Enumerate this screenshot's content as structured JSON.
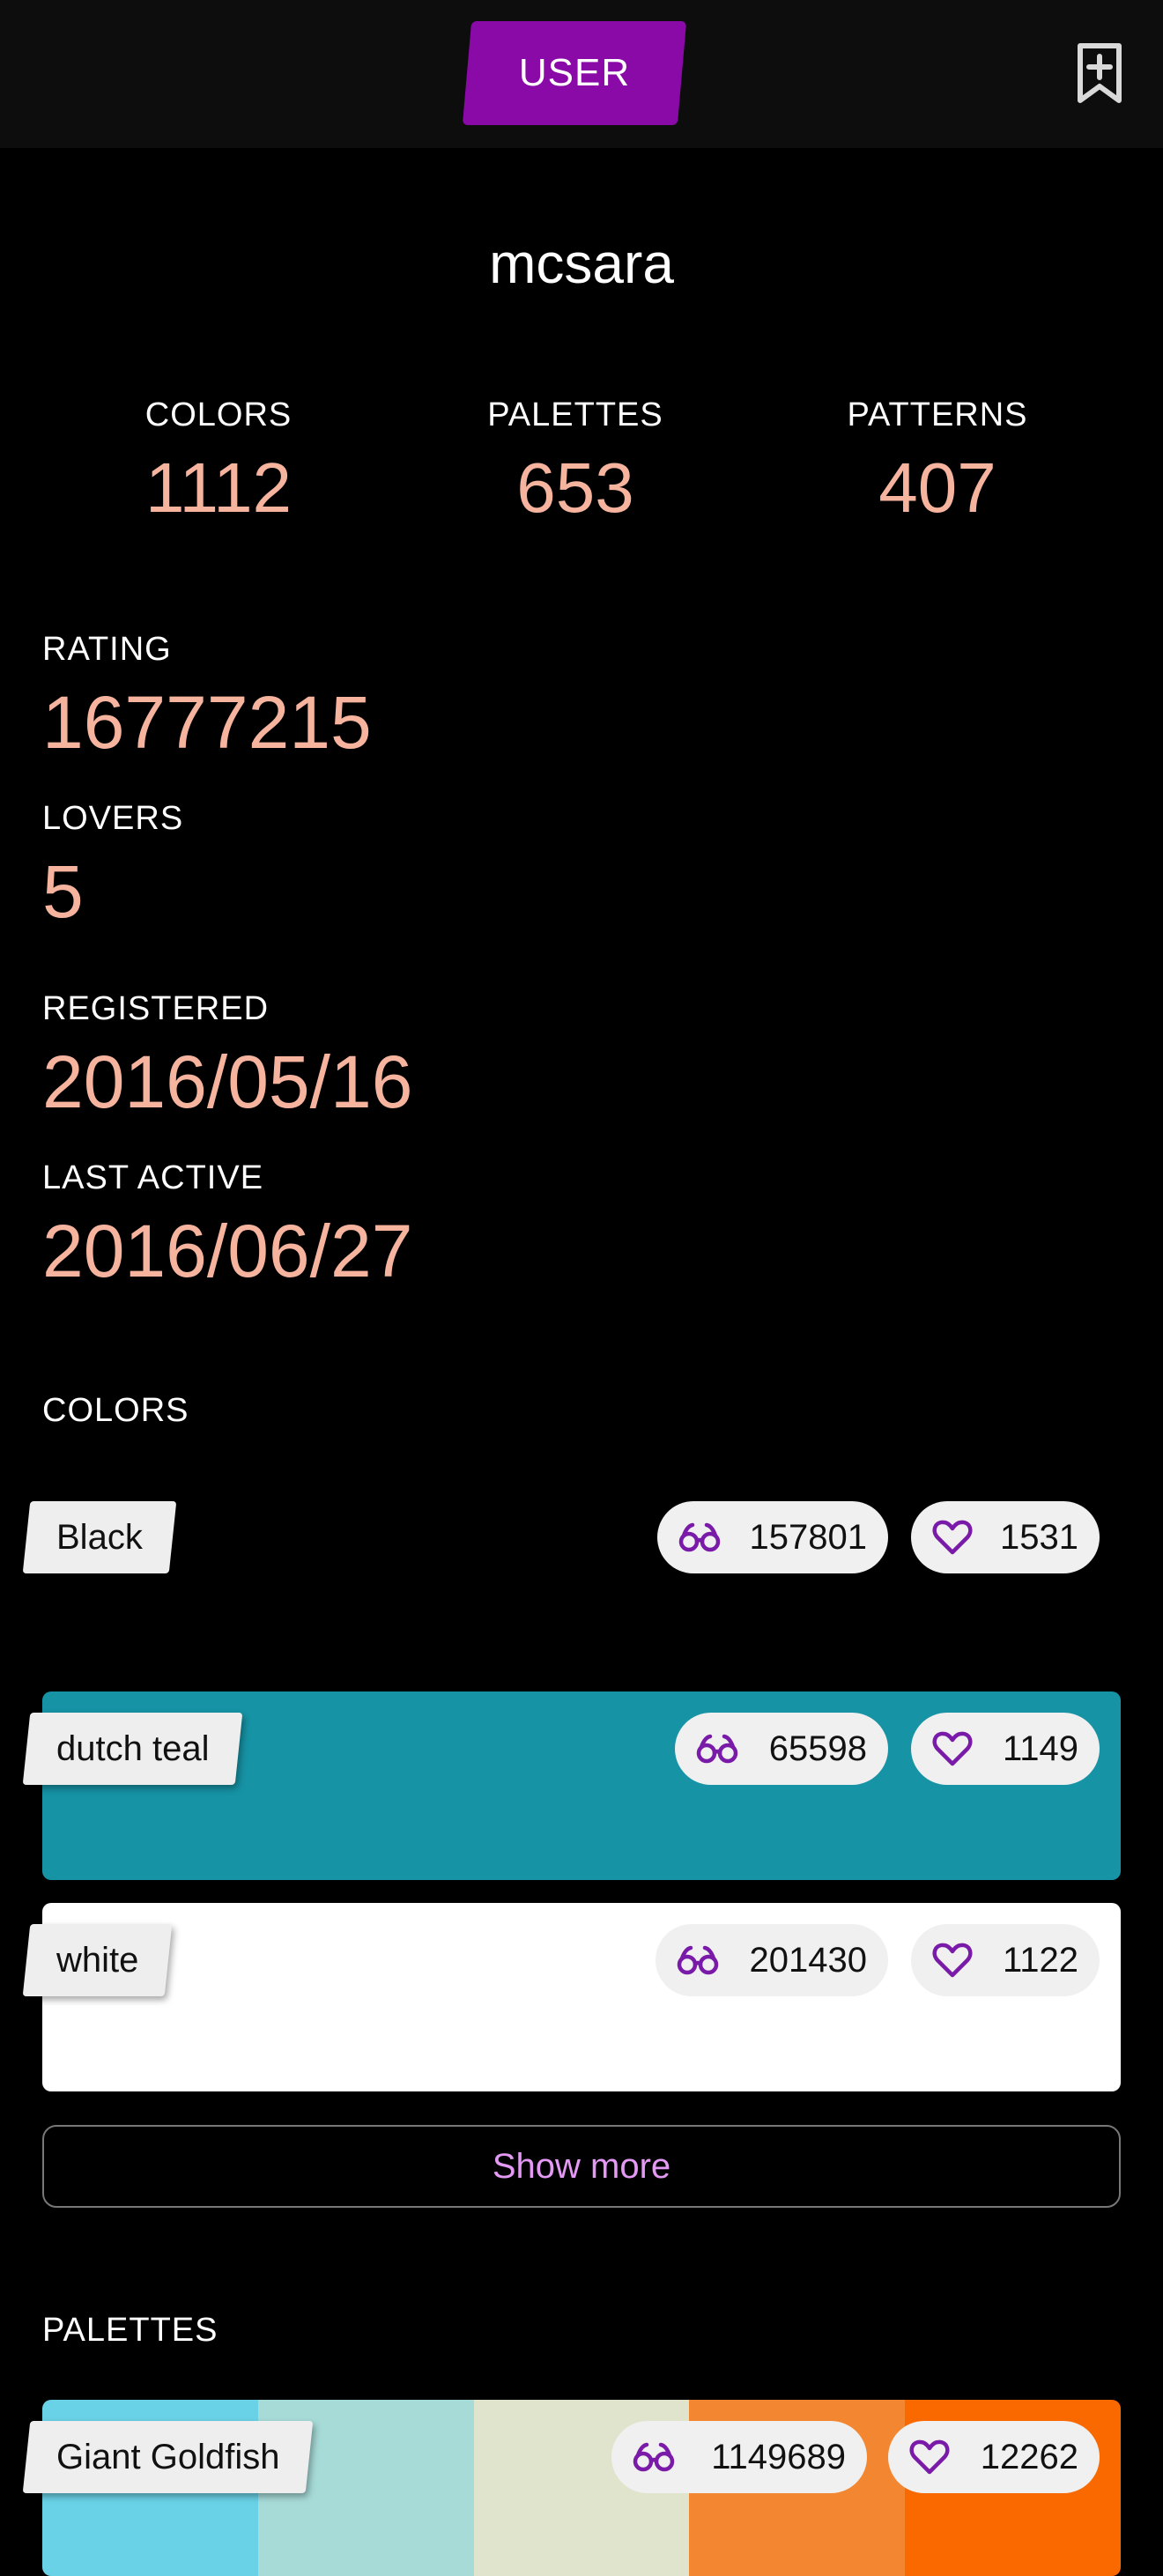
{
  "header": {
    "tab_label": "USER",
    "bookmark_icon": "bookmark-add-icon"
  },
  "profile": {
    "username": "mcsara"
  },
  "stats": [
    {
      "label": "COLORS",
      "value": "1112"
    },
    {
      "label": "PALETTES",
      "value": "653"
    },
    {
      "label": "PATTERNS",
      "value": "407"
    }
  ],
  "info": {
    "rating_label": "RATING",
    "rating_value": "16777215",
    "lovers_label": "LOVERS",
    "lovers_value": "5",
    "registered_label": "REGISTERED",
    "registered_value": "2016/05/16",
    "last_active_label": "LAST ACTIVE",
    "last_active_value": "2016/06/27"
  },
  "colors_section": {
    "title": "COLORS",
    "items": [
      {
        "name": "Black",
        "views": "157801",
        "loves": "1531",
        "color": "#000000"
      },
      {
        "name": "dutch teal",
        "views": "65598",
        "loves": "1149",
        "color": "#1693a5"
      },
      {
        "name": "white",
        "views": "201430",
        "loves": "1122",
        "color": "#ffffff"
      }
    ],
    "show_more_label": "Show more"
  },
  "palettes_section": {
    "title": "PALETTES",
    "items": [
      {
        "name": "Giant Goldfish",
        "views": "1149689",
        "loves": "12262",
        "colors": [
          "#69d2e7",
          "#a7dbd8",
          "#e0e4cc",
          "#f38630",
          "#fa6900"
        ]
      }
    ]
  },
  "theme": {
    "accent": "#8a0aa8",
    "value_color": "#f6b49f",
    "link_color": "#e49af4"
  }
}
